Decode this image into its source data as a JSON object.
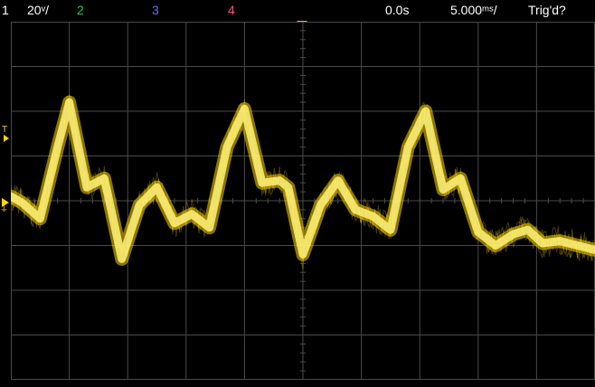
{
  "status_bar": {
    "channel_1": "1",
    "channel_1_scale": "20ᵛ/",
    "channel_2": "2",
    "channel_3": "3",
    "channel_4": "4",
    "time_offset": "0.0s",
    "time_scale": "5.000ᵐˢ/",
    "trigger_status": "Trig'd?"
  },
  "markers": {
    "trigger_level_label": "T",
    "ground_symbol": "⏚"
  },
  "colors": {
    "channel_1": "#ffd700",
    "channel_2": "#22c55e",
    "channel_3": "#5b6cff",
    "channel_4": "#ff4d8d",
    "trigger_marker": "#ff9f2a",
    "grid": "#4a4a4a"
  },
  "chart_data": {
    "type": "line",
    "title": "",
    "xlabel": "",
    "ylabel": "",
    "grid": true,
    "x_divisions": 10,
    "y_divisions": 8,
    "series": [
      {
        "x": [
          0,
          0.2,
          0.5,
          0.8,
          1.0,
          1.3,
          1.6,
          1.9,
          2.2,
          2.5,
          2.8,
          3.1,
          3.4,
          3.7,
          4.0,
          4.3,
          4.6,
          4.75,
          5.0,
          5.3,
          5.6,
          5.9,
          6.2,
          6.5,
          6.8,
          7.1,
          7.4,
          7.7,
          8.0,
          8.3,
          8.6,
          8.85,
          9.1,
          9.4,
          9.7,
          10.0
        ],
        "y": [
          0.1,
          -0.05,
          -0.4,
          1.2,
          2.2,
          0.3,
          0.5,
          -1.3,
          -0.1,
          0.3,
          -0.5,
          -0.3,
          -0.6,
          1.2,
          2.05,
          0.4,
          0.45,
          0.3,
          -1.2,
          -0.1,
          0.45,
          -0.2,
          -0.35,
          -0.65,
          1.2,
          2.0,
          0.25,
          0.5,
          -0.7,
          -1.0,
          -0.75,
          -0.65,
          -0.95,
          -0.9,
          -1.0,
          -1.1
        ]
      }
    ]
  }
}
